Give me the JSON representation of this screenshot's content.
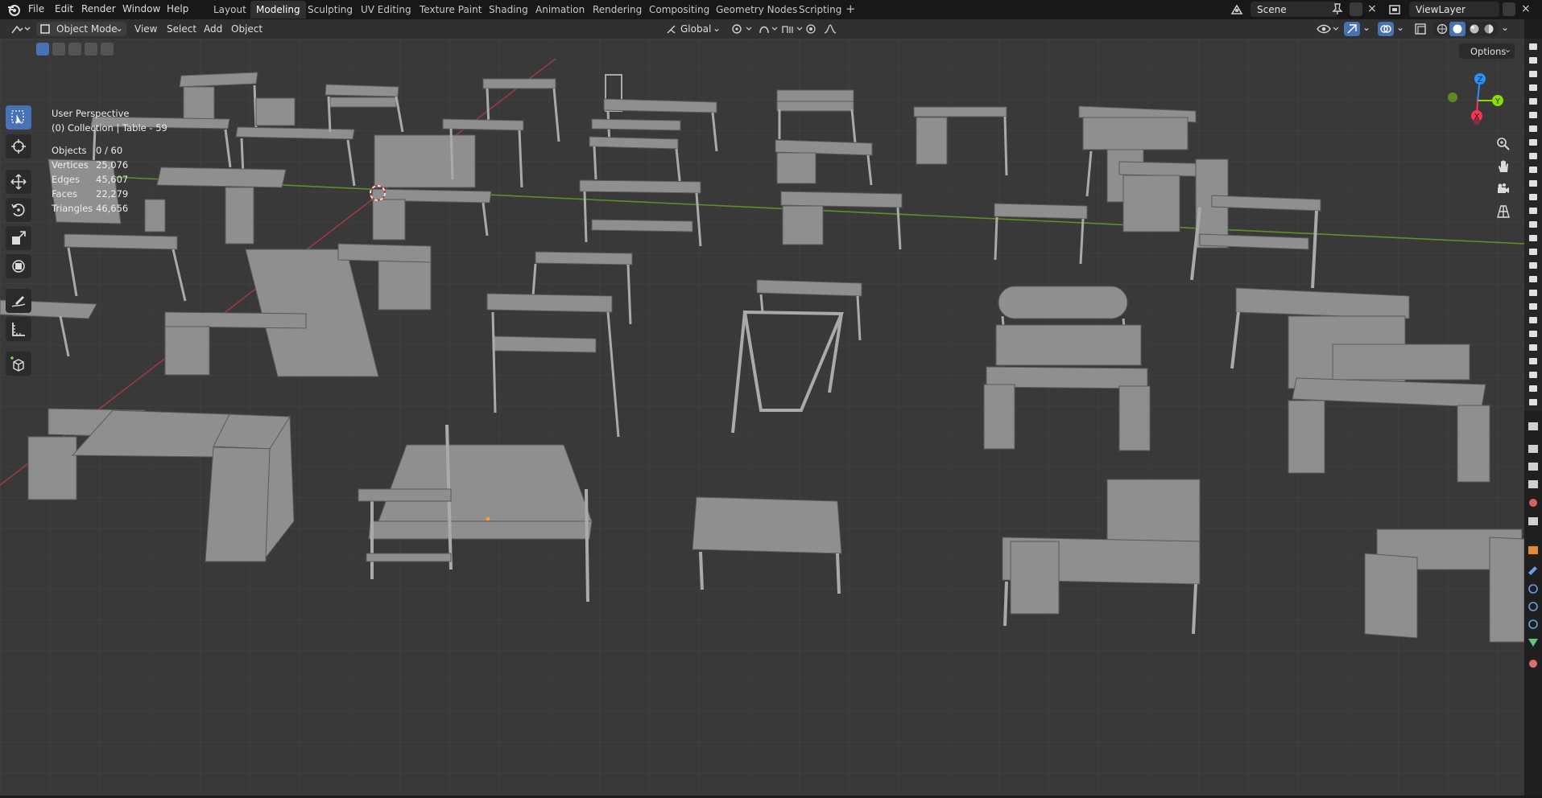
{
  "app": {
    "menus": [
      "File",
      "Edit",
      "Render",
      "Window",
      "Help"
    ],
    "workspace_tabs": [
      "Layout",
      "Modeling",
      "Sculpting",
      "UV Editing",
      "Texture Paint",
      "Shading",
      "Animation",
      "Rendering",
      "Compositing",
      "Geometry Nodes",
      "Scripting"
    ],
    "active_tab": "Modeling",
    "scene_name": "Scene",
    "view_layer": "ViewLayer"
  },
  "header": {
    "mode": "Object Mode",
    "menus": [
      "View",
      "Select",
      "Add",
      "Object"
    ],
    "orientation": "Global",
    "options_label": "Options"
  },
  "overlay": {
    "perspective": "User Perspective",
    "collection": "(0) Collection | Table - 59",
    "stats": [
      {
        "label": "Objects",
        "value": "0 / 60"
      },
      {
        "label": "Vertices",
        "value": "25,076"
      },
      {
        "label": "Edges",
        "value": "45,607"
      },
      {
        "label": "Faces",
        "value": "22,279"
      },
      {
        "label": "Triangles",
        "value": "46,656"
      }
    ]
  },
  "gizmo": {
    "x": "X",
    "y": "Y",
    "z": "Z"
  },
  "colors": {
    "accent": "#4772b3",
    "axis_x": "#ff3352",
    "axis_y": "#8bdc00",
    "axis_z": "#2890ff",
    "mesh": "#8e8e8e"
  },
  "tools": [
    "select-box-icon",
    "cursor-icon",
    "move-icon",
    "rotate-icon",
    "scale-icon",
    "transform-icon",
    "annotate-icon",
    "measure-icon",
    "add-cube-icon"
  ]
}
